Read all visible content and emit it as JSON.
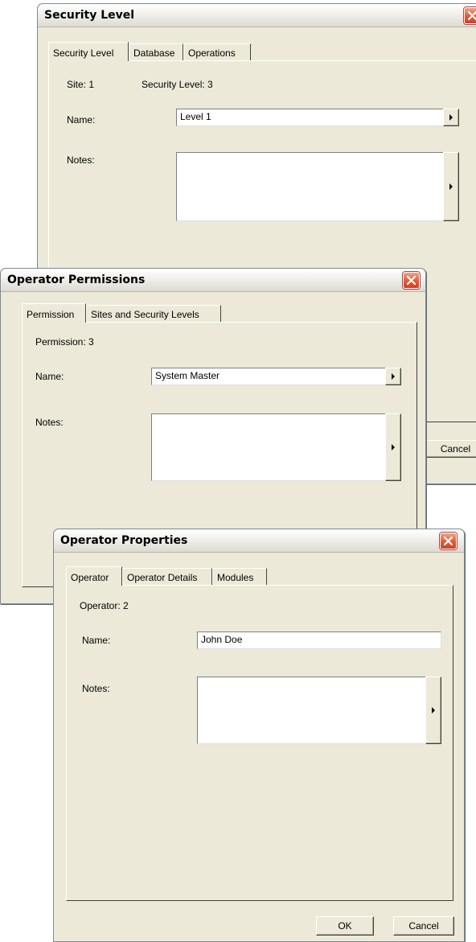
{
  "security_level_dialog": {
    "title": "Security Level",
    "tabs": [
      "Security Level",
      "Database",
      "Operations"
    ],
    "site_text": "Site: 1",
    "security_level_text": "Security Level: 3",
    "name_label": "Name:",
    "name_value": "Level 1",
    "notes_label": "Notes:",
    "notes_value": "",
    "cancel_label": "Cancel"
  },
  "operator_permissions_dialog": {
    "title": "Operator Permissions",
    "tabs": [
      "Permission",
      "Sites and Security Levels"
    ],
    "permission_text": "Permission: 3",
    "name_label": "Name:",
    "name_value": "System Master",
    "notes_label": "Notes:",
    "notes_value": ""
  },
  "operator_properties_dialog": {
    "title": "Operator Properties",
    "tabs": [
      "Operator",
      "Operator Details",
      "Modules"
    ],
    "operator_text": "Operator: 2",
    "name_label": "Name:",
    "name_value": "John Doe",
    "notes_label": "Notes:",
    "notes_value": "",
    "ok_label": "OK",
    "cancel_label": "Cancel"
  },
  "icons": {
    "close": "close-icon",
    "expand": "arrow-right-icon"
  },
  "colors": {
    "dialog_face": "#ece9d8",
    "close_button": "#e25a35",
    "window_border": "#7a8a99"
  }
}
